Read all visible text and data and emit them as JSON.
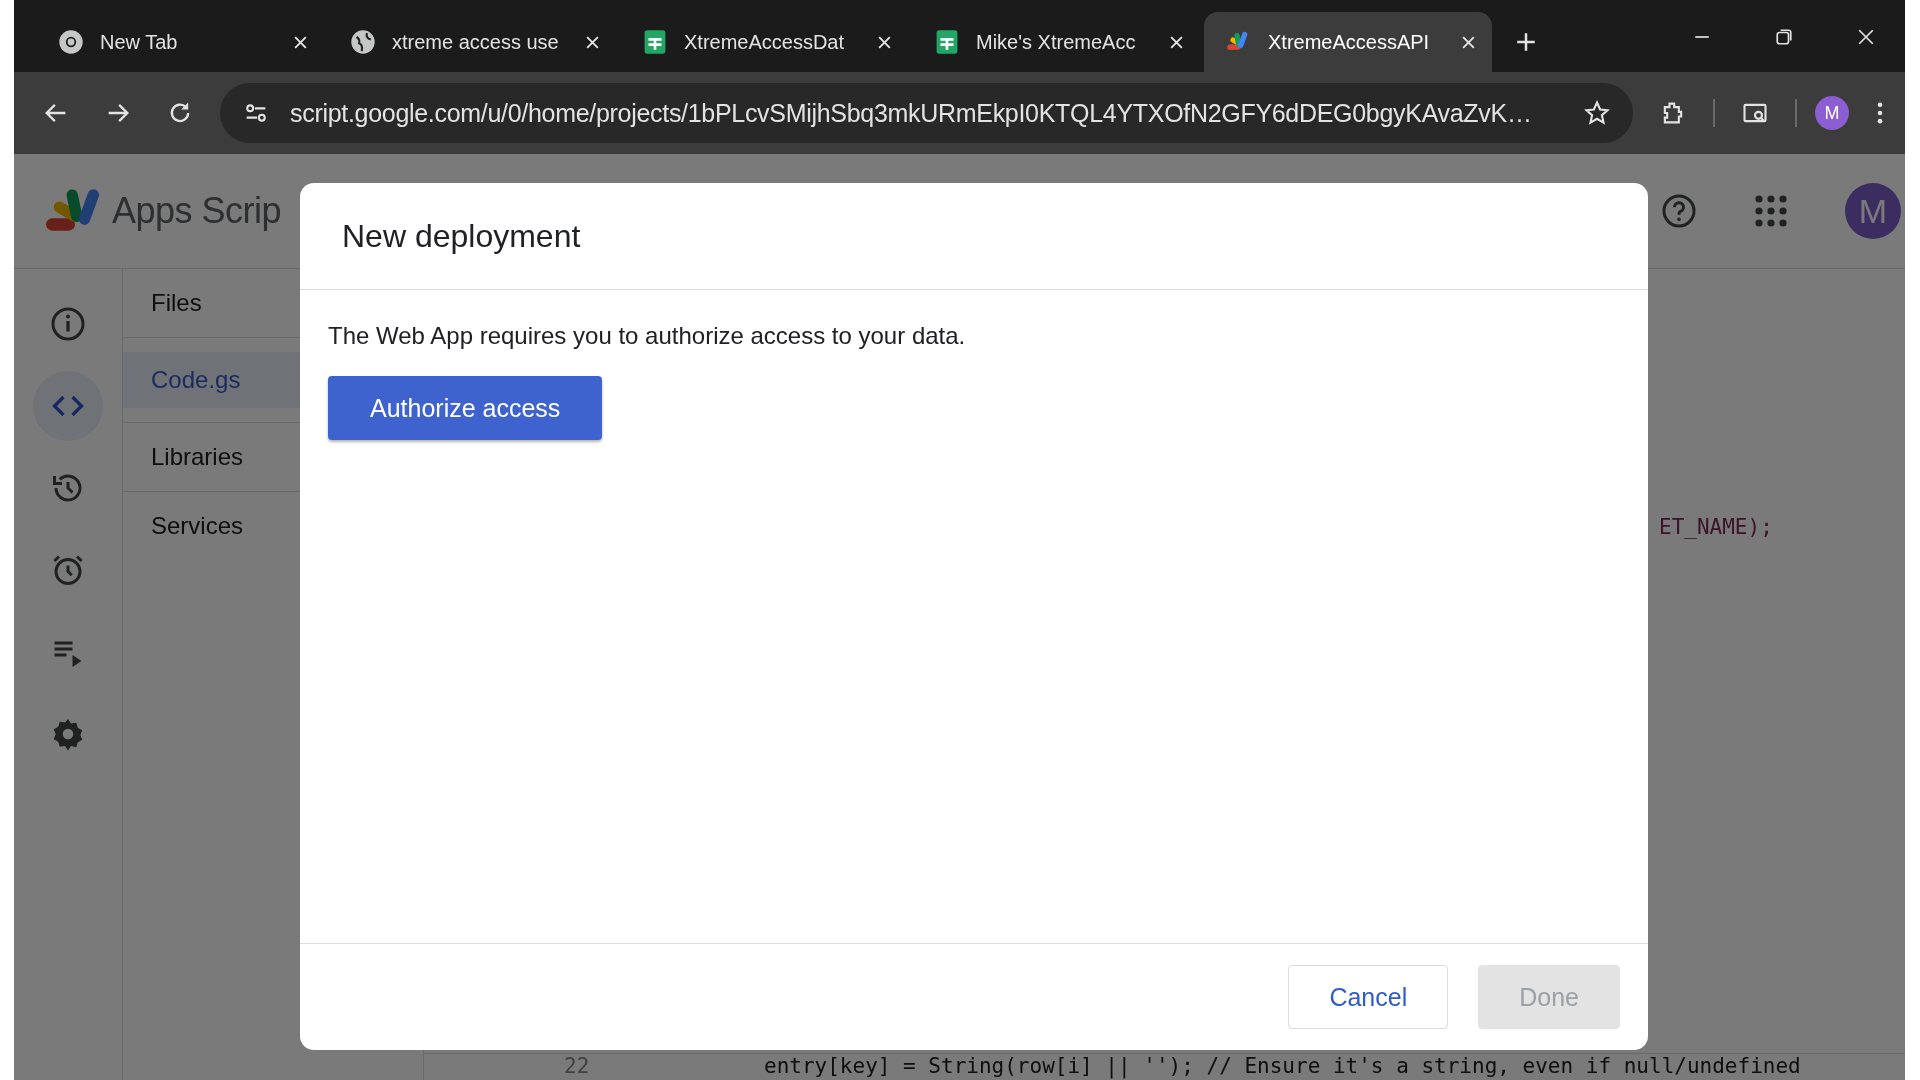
{
  "browser": {
    "tabs": [
      {
        "title": "New Tab",
        "kind": "chrome",
        "selected": false
      },
      {
        "title": "xtreme access use",
        "kind": "web",
        "selected": false
      },
      {
        "title": "XtremeAccessDat",
        "kind": "sheets",
        "selected": false
      },
      {
        "title": "Mike's XtremeAcc",
        "kind": "sheets",
        "selected": false
      },
      {
        "title": "XtremeAccessAPI",
        "kind": "script",
        "selected": true
      }
    ],
    "address": "script.google.com/u/0/home/projects/1bPLcvSMijhSbq3mkURmEkpI0KTQL4YTXOfN2GFY6dDEG0bgyKAvaZvK…",
    "profile": "M"
  },
  "app": {
    "name": "Apps Scrip",
    "avatar": "M",
    "rail": [
      {
        "kind": "info",
        "selected": false
      },
      {
        "kind": "code",
        "selected": true
      },
      {
        "kind": "history",
        "selected": false
      },
      {
        "kind": "triggers",
        "selected": false
      },
      {
        "kind": "executions",
        "selected": false
      },
      {
        "kind": "settings",
        "selected": false
      }
    ],
    "files_heading": "Files",
    "files": [
      {
        "name": "Code.gs",
        "selected": true
      }
    ],
    "sections": [
      "Libraries",
      "Services"
    ]
  },
  "editor": {
    "fragment": "ET_NAME);",
    "line_number": "22",
    "line": "entry[key] = String(row[i] || ''); // Ensure it's a string, even if null/undefined"
  },
  "dialog": {
    "title": "New deployment",
    "message": "The Web App requires you to authorize access to your data.",
    "action": "Authorize access",
    "buttons": [
      {
        "label": "Cancel",
        "disabled": false
      },
      {
        "label": "Done",
        "disabled": true
      }
    ]
  }
}
